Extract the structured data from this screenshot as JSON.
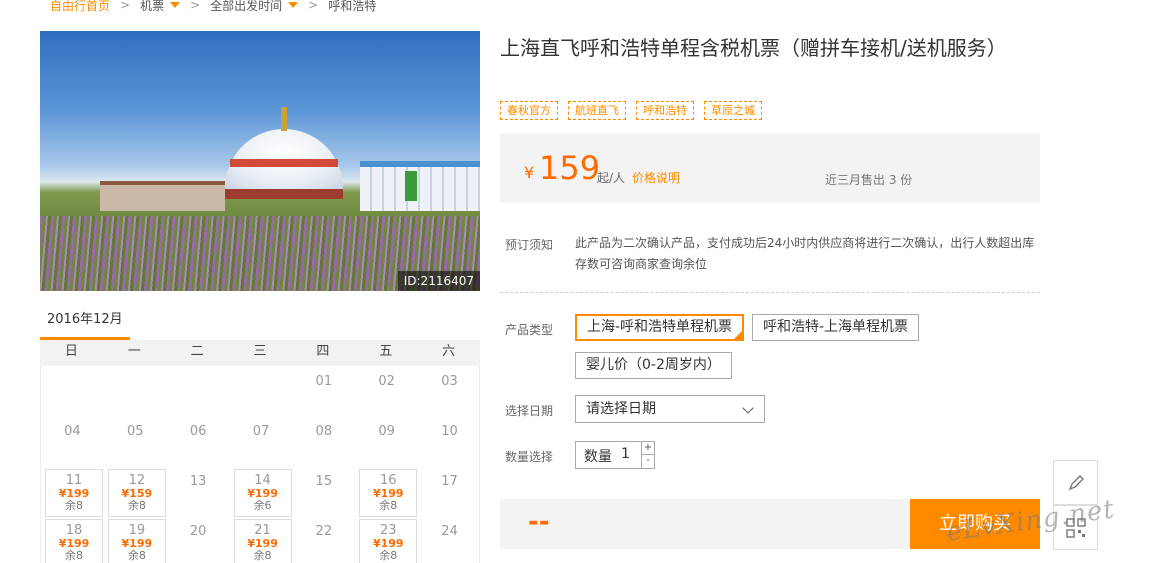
{
  "breadcrumb": {
    "items": [
      "自由行首页",
      "机票",
      "全部出发时间",
      "呼和浩特"
    ]
  },
  "photo": {
    "id_label": "ID:2116407"
  },
  "calendar": {
    "month": "2016年12月",
    "weekdays": [
      "日",
      "一",
      "二",
      "三",
      "四",
      "五",
      "六"
    ],
    "days": [
      {
        "d": "01"
      },
      {
        "d": "02"
      },
      {
        "d": "03"
      },
      {
        "d": "04"
      },
      {
        "d": "05"
      },
      {
        "d": "06"
      },
      {
        "d": "07"
      },
      {
        "d": "08"
      },
      {
        "d": "09"
      },
      {
        "d": "10"
      },
      {
        "d": "11",
        "price": "¥199",
        "stock": "余8"
      },
      {
        "d": "12",
        "price": "¥159",
        "stock": "余8"
      },
      {
        "d": "13"
      },
      {
        "d": "14",
        "price": "¥199",
        "stock": "余6"
      },
      {
        "d": "15"
      },
      {
        "d": "16",
        "price": "¥199",
        "stock": "余8"
      },
      {
        "d": "17"
      },
      {
        "d": "18",
        "price": "¥199",
        "stock": "余8"
      },
      {
        "d": "19",
        "price": "¥199",
        "stock": "余8"
      },
      {
        "d": "20"
      },
      {
        "d": "21",
        "price": "¥199",
        "stock": "余8"
      },
      {
        "d": "22"
      },
      {
        "d": "23",
        "price": "¥199",
        "stock": "余8"
      },
      {
        "d": "24"
      }
    ]
  },
  "product": {
    "title": "上海直飞呼和浩特单程含税机票（赠拼车接机/送机服务）",
    "tags": [
      "春秋官方",
      "航班直飞",
      "呼和浩特",
      "草原之城"
    ]
  },
  "price": {
    "currency": "¥",
    "amount": "159",
    "unit": "起/人",
    "note_link": "价格说明",
    "sold": "近三月售出 3 份"
  },
  "notice": {
    "label": "预订须知",
    "text": "此产品为二次确认产品，支付成功后24小时内供应商将进行二次确认，出行人数超出库存数可咨询商家查询余位"
  },
  "options": {
    "type_label": "产品类型",
    "types": [
      "上海-呼和浩特单程机票",
      "呼和浩特-上海单程机票",
      "婴儿价（0-2周岁内）"
    ],
    "date_label": "选择日期",
    "date_placeholder": "请选择日期",
    "qty_label": "数量选择",
    "qty_inner_label": "数量",
    "qty_value": "1",
    "plus": "+",
    "minus": "-"
  },
  "buy": {
    "total": "--",
    "button": "立即购买"
  },
  "side": [
    "edit-icon",
    "qrcode-icon"
  ],
  "watermark": "eLvXing.net",
  "colors": {
    "accent": "#ff8a00",
    "price": "#ff6a00"
  }
}
